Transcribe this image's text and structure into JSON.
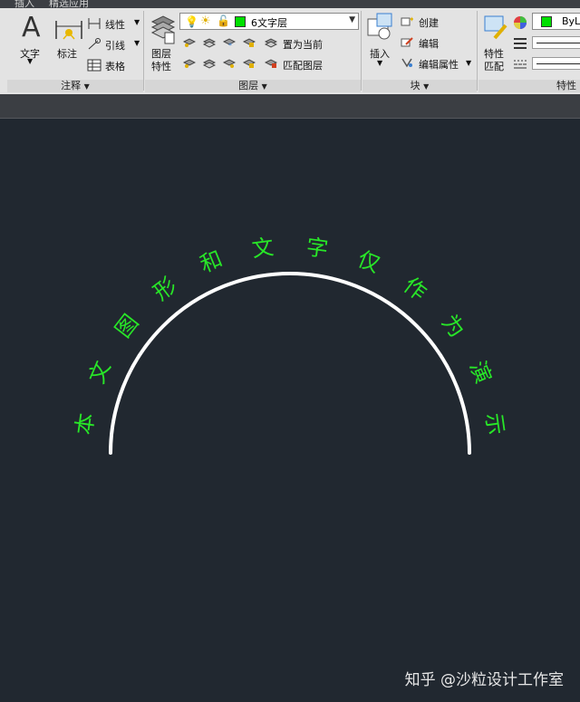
{
  "tabs": {
    "left": "插入",
    "right": "精选应用"
  },
  "annotation": {
    "text_label": "文字",
    "dim_label": "标注",
    "linear_label": "线性",
    "leader_label": "引线",
    "table_label": "表格",
    "panel_title": "注释"
  },
  "layers": {
    "props_label_1": "图层",
    "props_label_2": "特性",
    "current_layer": "6文字层",
    "set_current_label": "置为当前",
    "match_layer_label": "匹配图层",
    "panel_title": "图层"
  },
  "block": {
    "insert_label": "插入",
    "create_label": "创建",
    "edit_label": "编辑",
    "edit_attr_label": "编辑属性",
    "panel_title": "块"
  },
  "properties": {
    "match_label_1": "特性",
    "match_label_2": "匹配",
    "bylayer_label": "ByL",
    "panel_title": "特性"
  },
  "drawing": {
    "arc_chars": [
      "本",
      "文",
      "图",
      "形",
      "和",
      "文",
      "字",
      "仅",
      "作",
      "为",
      "演",
      "示"
    ]
  },
  "watermark": "知乎 @沙粒设计工作室",
  "colors": {
    "canvas": "#212830",
    "text_green": "#28e628",
    "arc": "#ffffff",
    "layer_color": "#00e000"
  }
}
